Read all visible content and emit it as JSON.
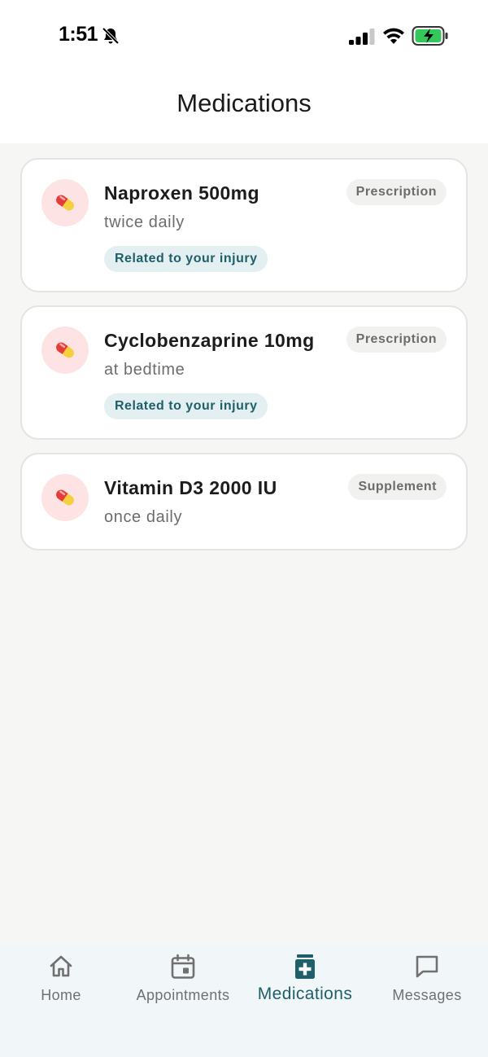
{
  "status_bar": {
    "time": "1:51",
    "icons": [
      "bell-slash-icon",
      "cellular-signal-icon",
      "wifi-icon",
      "battery-charging-icon"
    ]
  },
  "header": {
    "title": "Medications"
  },
  "colors": {
    "accent": "#1e5f6a",
    "card_border": "#e4e4e2",
    "background": "#f6f6f4",
    "pill_circle": "#fde3e3",
    "injury_badge_bg": "#e3eff1",
    "battery_green": "#34c759"
  },
  "medications": [
    {
      "name": "Naproxen 500mg",
      "dose": "twice daily",
      "type": "Prescription",
      "related": "Related to your injury",
      "icon": "pill-icon"
    },
    {
      "name": "Cyclobenzaprine 10mg",
      "dose": "at bedtime",
      "type": "Prescription",
      "related": "Related to your injury",
      "icon": "pill-icon"
    },
    {
      "name": "Vitamin D3 2000 IU",
      "dose": "once daily",
      "type": "Supplement",
      "icon": "pill-icon"
    }
  ],
  "nav": {
    "active": "Medications",
    "items": [
      {
        "label": "Home",
        "icon": "home-icon"
      },
      {
        "label": "Appointments",
        "icon": "calendar-icon"
      },
      {
        "label": "Medications",
        "icon": "medical-bottle-icon"
      },
      {
        "label": "Messages",
        "icon": "chat-bubble-icon"
      }
    ]
  }
}
